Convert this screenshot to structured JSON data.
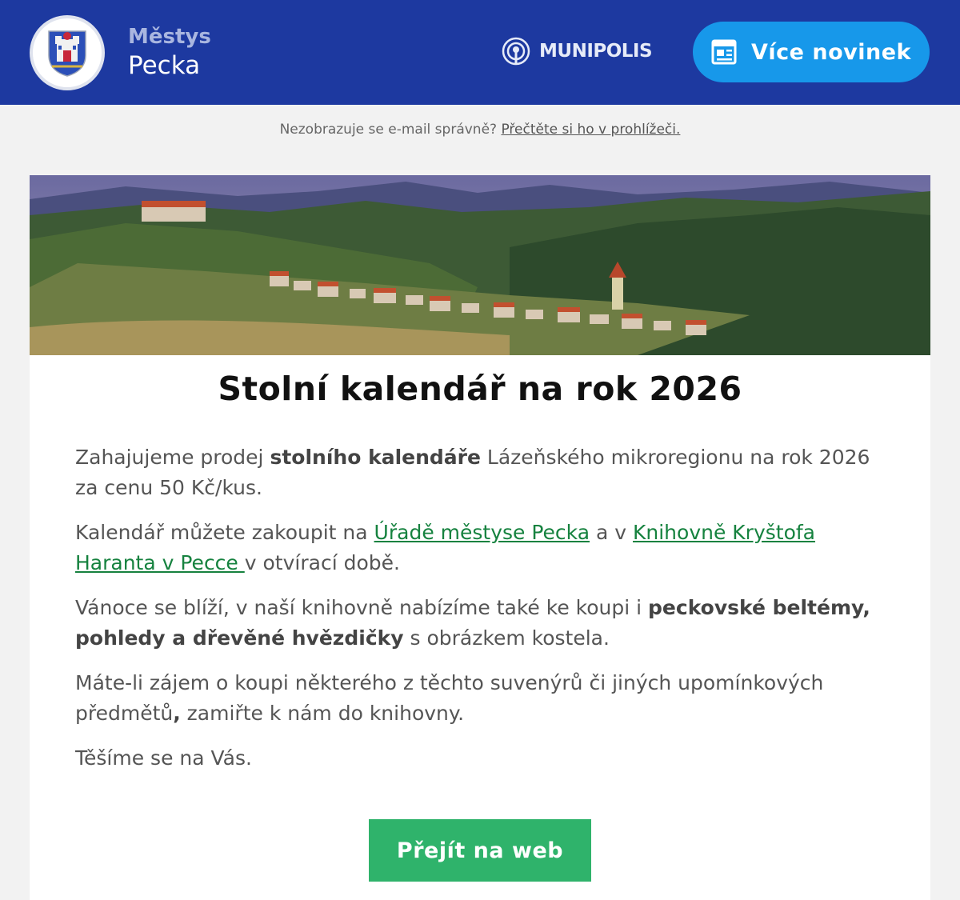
{
  "header": {
    "brand_sub": "Městys",
    "brand_main": "Pecka",
    "partner": "MUNIPOLIS",
    "more_news_label": "Více novinek",
    "colors": {
      "background": "#1d39a0",
      "button": "#1798ea"
    }
  },
  "preheader": {
    "text": "Nezobrazuje se e-mail správně?",
    "link": "Přečtěte si ho v prohlížeči."
  },
  "article": {
    "title": "Stolní kalendář na rok 2026",
    "p1": {
      "a": "Zahajujeme prodej ",
      "b": "stolního kalendáře",
      "c": " Lázeňského mikroregionu na rok 2026 za cenu 50 Kč/kus."
    },
    "p2": {
      "a": "Kalendář můžete zakoupit na ",
      "link1": "Úřadě městyse Pecka",
      "b": " a v ",
      "link2": "Knihovně Kryštofa Haranta v Pecce ",
      "c": "v otvírací době."
    },
    "p3": {
      "a": "Vánoce se blíží, v naší knihovně nabízíme také ke koupi i ",
      "b": "peckovské bel­témy, pohledy a dřevěné hvězdičky",
      "c": " s obrázkem kostela."
    },
    "p4": {
      "a": "Máte-li zájem o koupi některého z těchto suvenýrů či jiných upomínkových předmětů",
      "b": ",",
      "c": " zamiřte k nám do knihovny."
    },
    "p5": "Těšíme se na Vás.",
    "cta_label": "Přejít na web",
    "link_color": "#16823f",
    "cta_color": "#2fb36b"
  }
}
